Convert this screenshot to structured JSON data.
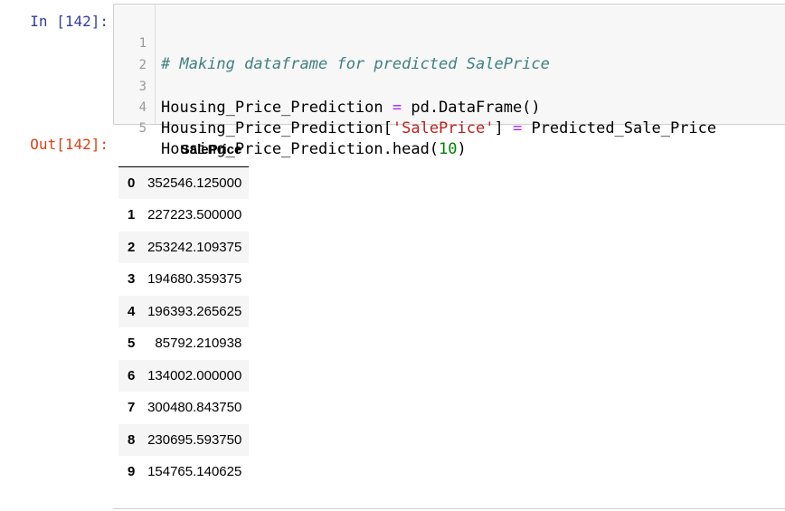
{
  "input_prompt": "In [142]:",
  "output_prompt": "Out[142]:",
  "code": {
    "line_numbers": [
      "1",
      "2",
      "3",
      "4",
      "5"
    ],
    "line1": {
      "comment": "# Making dataframe for predicted SalePrice"
    },
    "line3": {
      "lhs": "Housing_Price_Prediction ",
      "op": "=",
      "rhs": " pd.DataFrame()"
    },
    "line4": {
      "lhs_a": "Housing_Price_Prediction[",
      "key": "'SalePrice'",
      "lhs_b": "] ",
      "op": "=",
      "rhs": " Predicted_Sale_Price"
    },
    "line5": {
      "call": "Housing_Price_Prediction.head(",
      "arg": "10",
      "close": ")"
    }
  },
  "output_table": {
    "index_header": "",
    "column_header": "SalePrice",
    "rows": [
      {
        "index": "0",
        "value": "352546.125000"
      },
      {
        "index": "1",
        "value": "227223.500000"
      },
      {
        "index": "2",
        "value": "253242.109375"
      },
      {
        "index": "3",
        "value": "194680.359375"
      },
      {
        "index": "4",
        "value": "196393.265625"
      },
      {
        "index": "5",
        "value": "85792.210938"
      },
      {
        "index": "6",
        "value": "134002.000000"
      },
      {
        "index": "7",
        "value": "300480.843750"
      },
      {
        "index": "8",
        "value": "230695.593750"
      },
      {
        "index": "9",
        "value": "154765.140625"
      }
    ]
  }
}
